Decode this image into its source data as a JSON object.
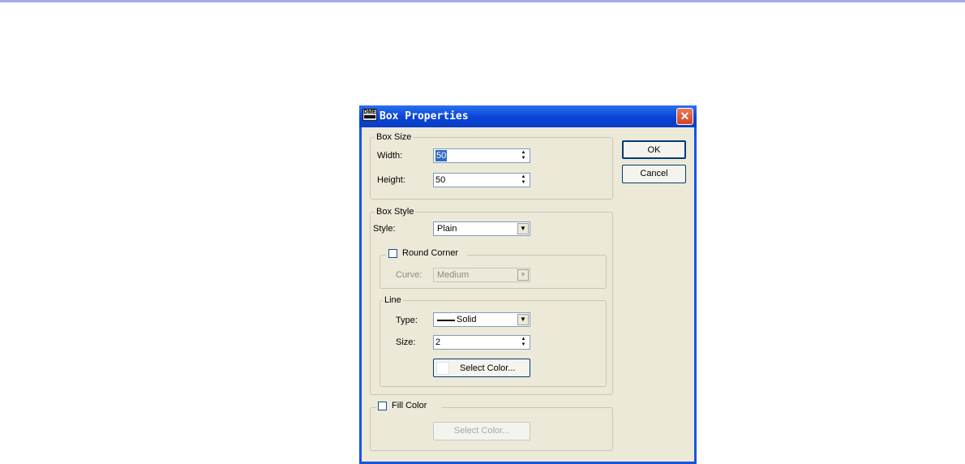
{
  "window": {
    "title": "Box Properties",
    "icon": "DME",
    "close_glyph": "✕"
  },
  "buttons": {
    "ok": "OK",
    "cancel": "Cancel"
  },
  "box_size": {
    "legend": "Box Size",
    "width_label": "Width:",
    "width_value": "50",
    "height_label": "Height:",
    "height_value": "50"
  },
  "box_style": {
    "legend": "Box Style",
    "style_label": "Style:",
    "style_value": "Plain",
    "round_corner": {
      "label": "Round Corner",
      "checked": false,
      "curve_label": "Curve:",
      "curve_value": "Medium"
    },
    "line": {
      "legend": "Line",
      "type_label": "Type:",
      "type_value": "Solid",
      "size_label": "Size:",
      "size_value": "2",
      "color_button": "Select Color..."
    }
  },
  "fill_color": {
    "label": "Fill Color",
    "checked": false,
    "color_button": "Select Color..."
  },
  "glyphs": {
    "spin_up": "▲",
    "spin_down": "▼",
    "drop": "▼"
  }
}
